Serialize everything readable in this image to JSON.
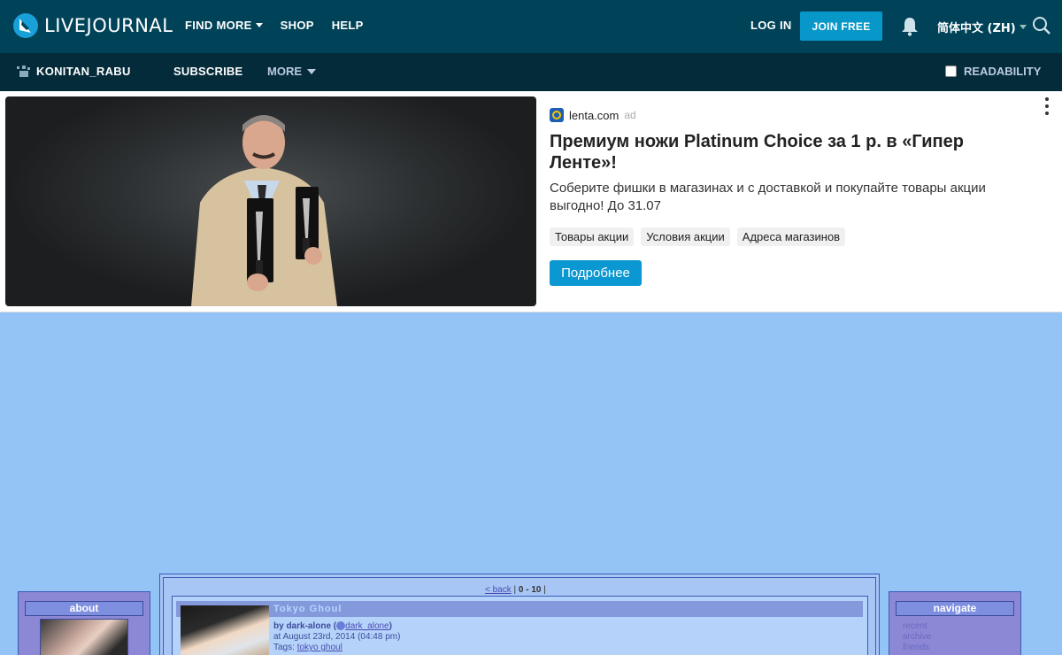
{
  "topbar": {
    "brand": "LIVEJOURNAL",
    "nav": [
      "FIND MORE",
      "SHOP",
      "HELP"
    ],
    "login": "LOG IN",
    "join": "JOIN FREE",
    "language": "简体中文 (ZH)"
  },
  "subbar": {
    "username": "KONITAN_RABU",
    "subscribe": "SUBSCRIBE",
    "more": "MORE",
    "readability": "READABILITY"
  },
  "ad": {
    "source": "lenta.com",
    "ad_label": "ad",
    "title": "Премиум ножи Platinum Choice за 1 р. в «Гипер Ленте»!",
    "description": "Соберите фишки в магазинах и с доставкой и покупайте товары акции выгодно! До 31.07",
    "tags": [
      "Товары акции",
      "Условия акции",
      "Адреса магазинов"
    ],
    "button": "Подробнее"
  },
  "journal": {
    "left_header": "about",
    "right_header": "navigate",
    "nav_links": [
      "recent",
      "archive",
      "friends"
    ],
    "pager_back": "< back",
    "pager_range": "0 - 10",
    "entry": {
      "title": "Tokyo Ghoul",
      "by_label": "by dark-alone (",
      "user_link": "dark_alone",
      "by_suffix": ")",
      "date": "at August 23rd, 2014 (04:48 pm)",
      "tags_label": "Tags:",
      "tag": "tokyo ghoul"
    }
  },
  "colors": {
    "topbar": "#004359",
    "subbar": "#042b3a",
    "join": "#0797c9",
    "page_bg": "#94c4f5",
    "ad_button": "#0b97d2"
  }
}
